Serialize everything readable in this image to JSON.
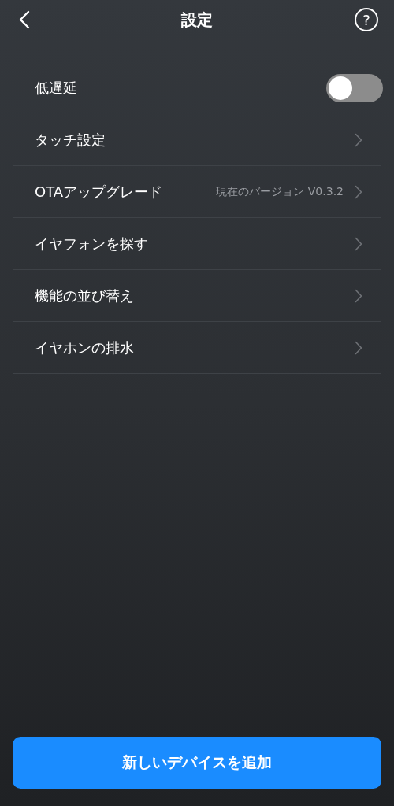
{
  "header": {
    "title": "設定",
    "help": "?"
  },
  "items": [
    {
      "kind": "toggle",
      "label": "低遅延",
      "on": false
    },
    {
      "kind": "link",
      "label": "タッチ設定"
    },
    {
      "kind": "link",
      "label": "OTAアップグレード",
      "value": "現在のバージョン V0.3.2"
    },
    {
      "kind": "link",
      "label": "イヤフォンを探す"
    },
    {
      "kind": "link",
      "label": "機能の並び替え"
    },
    {
      "kind": "link",
      "label": "イヤホンの排水"
    }
  ],
  "button": "新しいデバイスを追加"
}
